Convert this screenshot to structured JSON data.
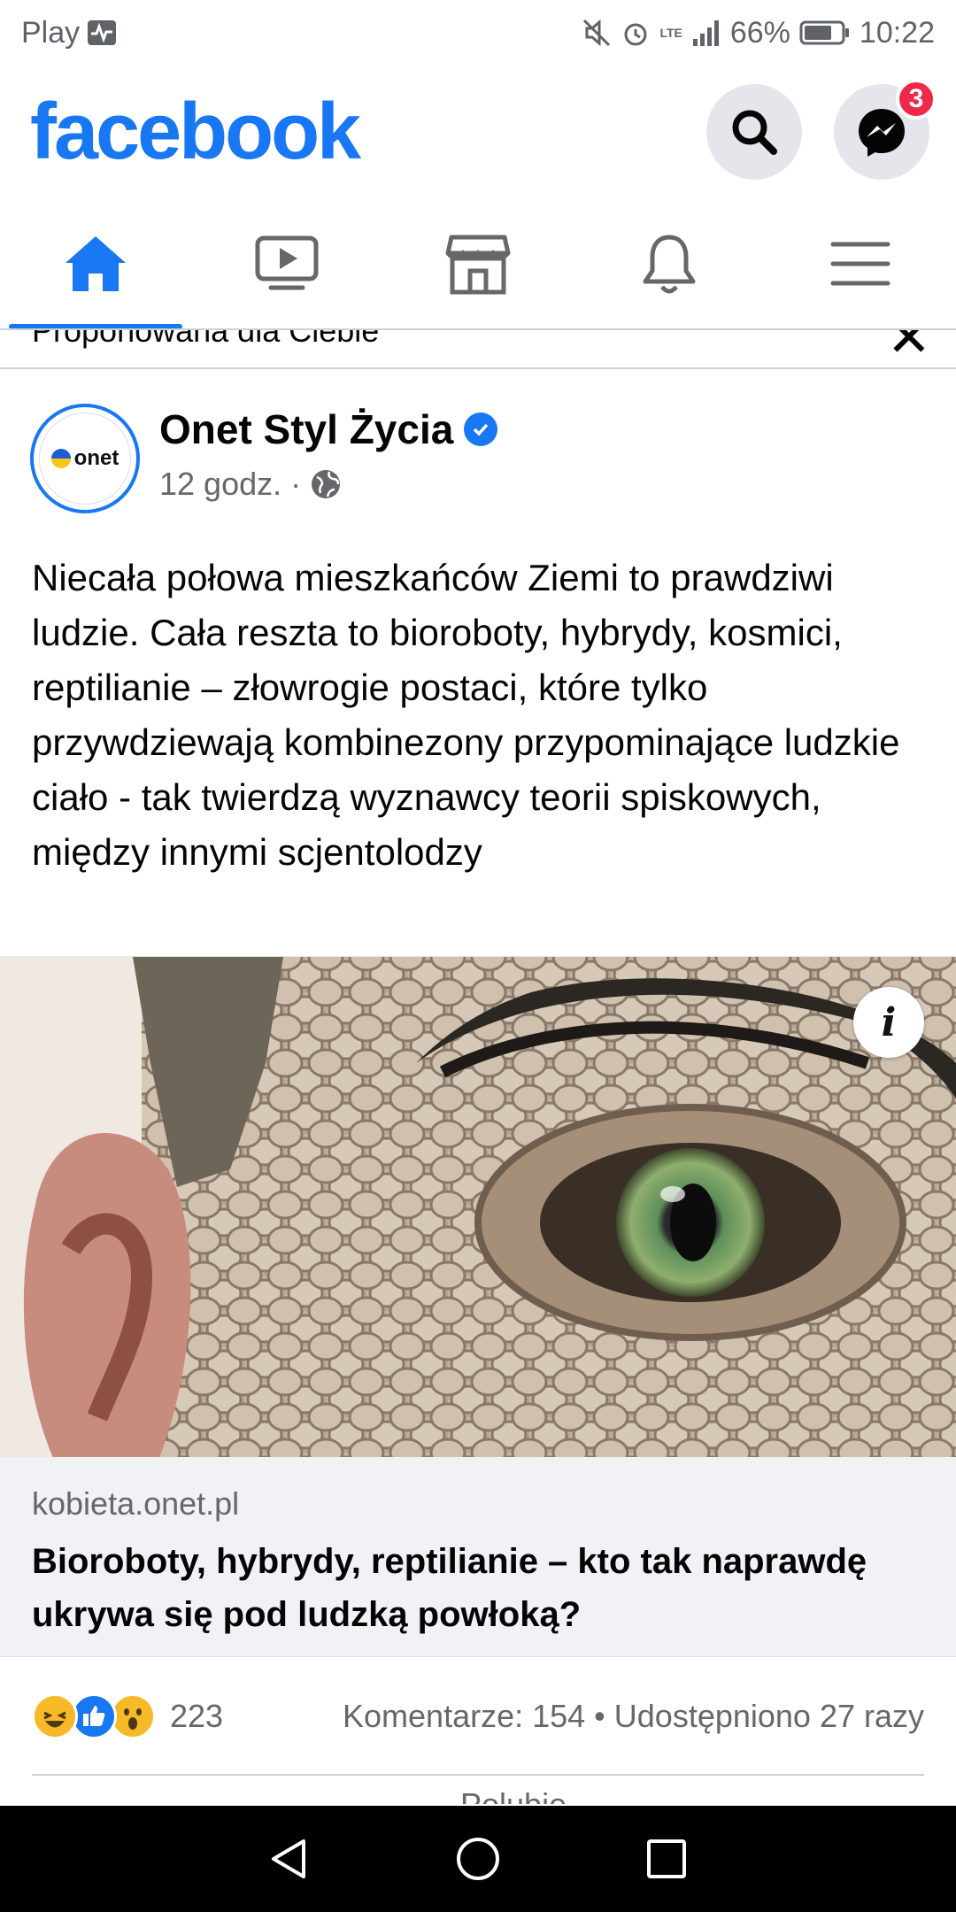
{
  "status_bar": {
    "carrier": "Play",
    "battery": "66%",
    "time": "10:22",
    "network": "LTE"
  },
  "header": {
    "logo": "facebook",
    "messenger_badge": "3",
    "brand_color": "#1877f2"
  },
  "tabs": [
    {
      "name": "home",
      "icon": "home-icon",
      "active": true
    },
    {
      "name": "watch",
      "icon": "video-icon",
      "active": false
    },
    {
      "name": "marketplace",
      "icon": "store-icon",
      "active": false
    },
    {
      "name": "notifications",
      "icon": "bell-icon",
      "active": false
    },
    {
      "name": "menu",
      "icon": "menu-icon",
      "active": false
    }
  ],
  "suggested": {
    "label": "Proponowana dla Ciebie"
  },
  "post": {
    "page_name": "Onet Styl Życia",
    "avatar_text": "onet",
    "time": "12 godz.",
    "separator": "·",
    "text": "Niecała połowa mieszkańców Ziemi to prawdziwi ludzie. Cała reszta to bioroboty, hybrydy, kosmici, reptilianie – złowrogie postaci, które tylko przywdziewają kombinezony przypominające ludzkie ciało - tak twierdzą wyznawcy teorii spiskowych, między innymi scjentolodzy",
    "image_info": "i",
    "link": {
      "domain": "kobieta.onet.pl",
      "title": "Bioroboty, hybrydy, reptilianie – kto tak naprawdę ukrywa się pod ludzką powłoką?"
    },
    "reactions": {
      "count": "223",
      "comments_shares": "Komentarze: 154 • Udostępniono 27 razy"
    },
    "peek": "Polubię"
  }
}
